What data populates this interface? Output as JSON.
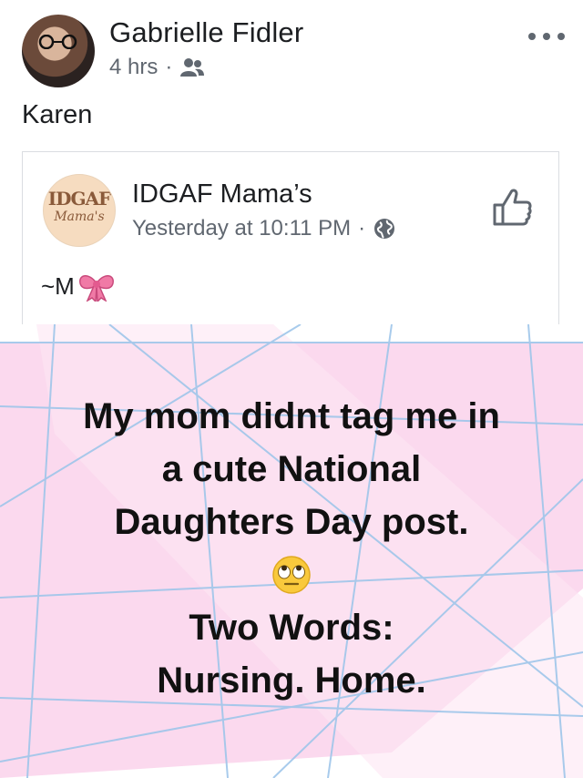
{
  "post": {
    "author": "Gabrielle Fidler",
    "time": "4 hrs",
    "separator": "·",
    "audience_icon": "friends-icon",
    "more_icon": "more-options-icon",
    "text": "Karen"
  },
  "shared": {
    "page_name": "IDGAF Mama’s",
    "logo_top": "IDGAF",
    "logo_bottom": "Mama's",
    "time": "Yesterday at 10:11 PM",
    "separator": "·",
    "privacy_icon": "globe-icon",
    "like_icon": "like-icon",
    "text": "~M",
    "text_emoji_icon": "ribbon-icon"
  },
  "image": {
    "lines": [
      "My mom didnt tag me in",
      "a cute National",
      "Daughters Day post."
    ],
    "emoji_icon": "eye-roll-emoji-icon",
    "lines2": [
      "Two Words:",
      "Nursing. Home."
    ],
    "colors": {
      "pink": "#fbd9ee",
      "grid": "#9fc6ea"
    }
  }
}
